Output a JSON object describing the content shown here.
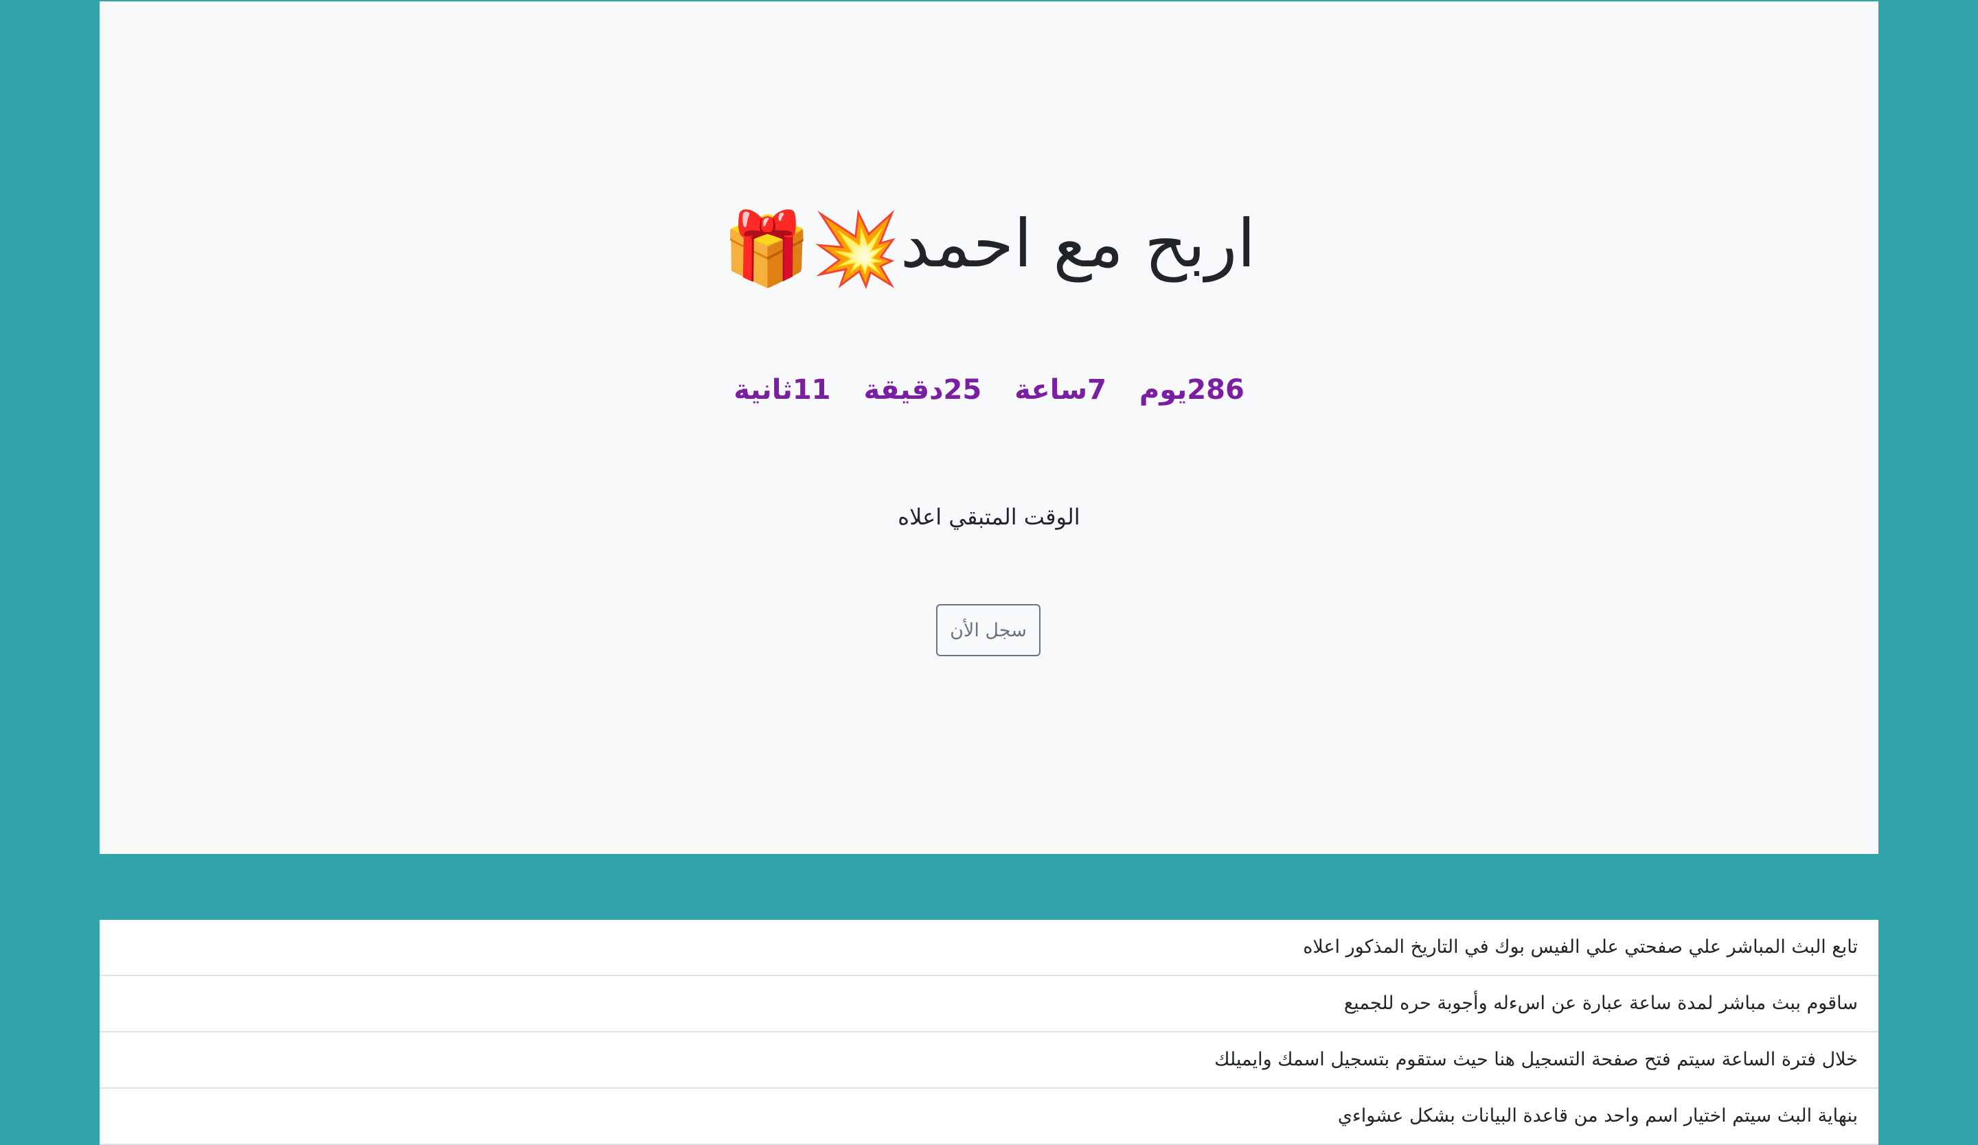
{
  "hero": {
    "title": "اربح مع احمد",
    "emojis": [
      "💥",
      "🎁"
    ],
    "countdown": {
      "days": {
        "value": "286",
        "label": "يوم"
      },
      "hours": {
        "value": "7",
        "label": "ساعة"
      },
      "minutes": {
        "value": "25",
        "label": "دقيقة"
      },
      "seconds": {
        "value": "11",
        "label": "ثانية"
      }
    },
    "remaining_text": "الوقت المتبقي اعلاه",
    "register_label": "سجل الأن"
  },
  "info_list": [
    "تابع البث المباشر علي صفحتي علي الفيس بوك في التاريخ المذكور اعلاه",
    "ساقوم ببث مباشر لمدة ساعة عبارة عن اسءله وأجوبة حره للجميع",
    "خلال فترة الساعة سيتم فتح صفحة التسجيل هنا حيث ستقوم بتسجيل اسمك وايميلك",
    "بنهاية البث سيتم اختيار اسم واحد من قاعدة البيانات بشكل عشواءي"
  ],
  "colors": {
    "background": "#32a5aa",
    "hero_background": "#f8f9fa",
    "countdown": "#7b1fa2",
    "button_border": "#6c757d"
  }
}
